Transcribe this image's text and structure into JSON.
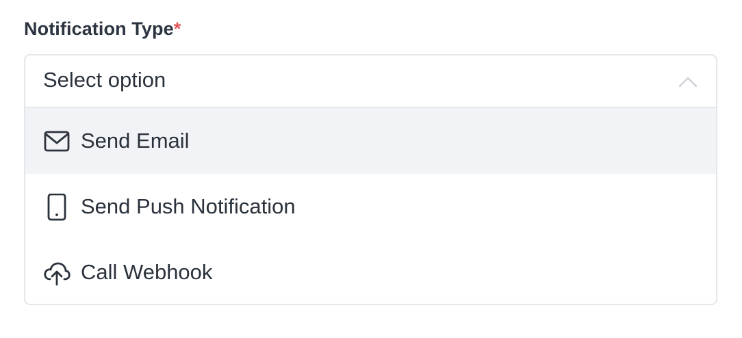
{
  "field": {
    "label": "Notification Type",
    "required_mark": "*"
  },
  "select": {
    "value": "Select option",
    "expanded": true,
    "options": [
      {
        "label": "Send Email",
        "icon": "mail-icon",
        "highlighted": true
      },
      {
        "label": "Send Push Notification",
        "icon": "mobile-device-icon",
        "highlighted": false
      },
      {
        "label": "Call Webhook",
        "icon": "cloud-upload-icon",
        "highlighted": false
      }
    ]
  },
  "colors": {
    "text": "#2a323c",
    "required": "#e25454",
    "border": "#e3e6ea",
    "highlight": "#f2f3f6"
  }
}
